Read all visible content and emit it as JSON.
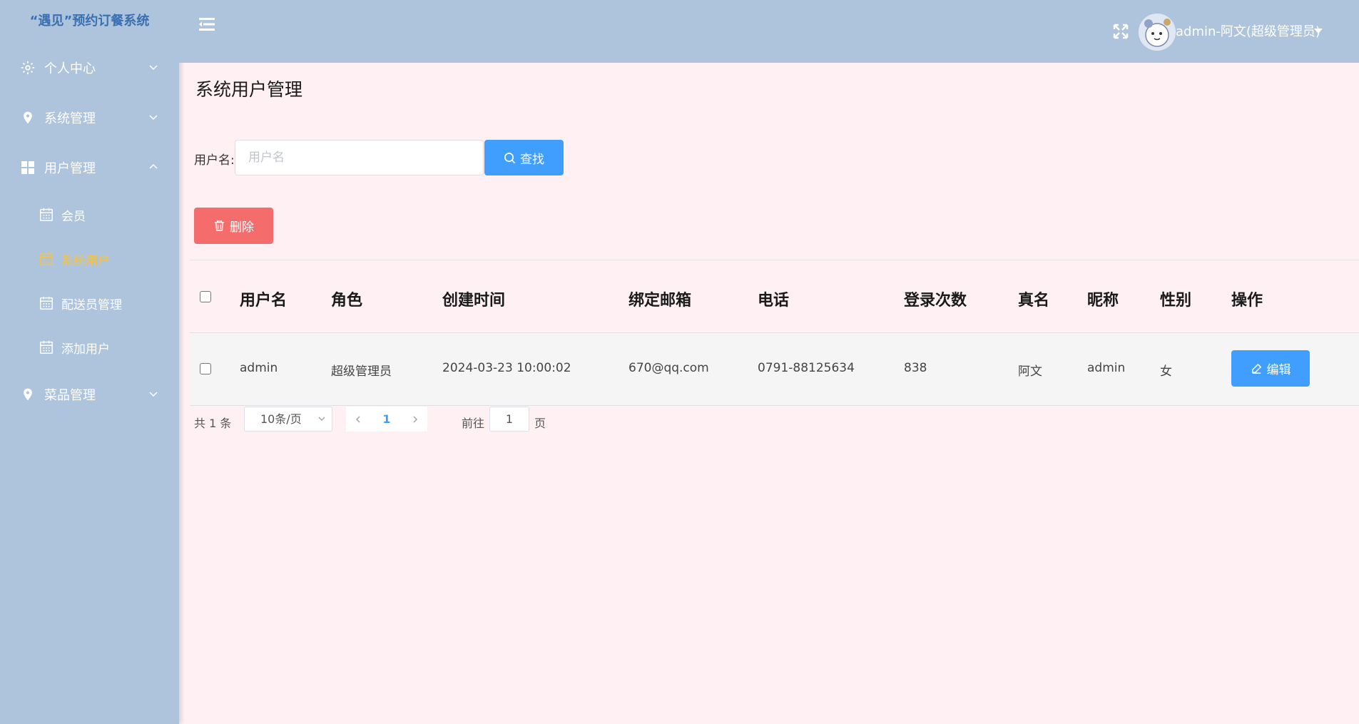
{
  "app": {
    "title": "“遇见”预约订餐系统"
  },
  "sidebar": {
    "items": [
      {
        "label": "个人中心",
        "icon": "gear-icon",
        "expanded": false
      },
      {
        "label": "系统管理",
        "icon": "location-pin-icon",
        "expanded": false
      },
      {
        "label": "用户管理",
        "icon": "grid-icon",
        "expanded": true,
        "children": [
          {
            "label": "会员",
            "icon": "calendar-icon",
            "active": false
          },
          {
            "label": "系统用户",
            "icon": "calendar-icon",
            "active": true
          },
          {
            "label": "配送员管理",
            "icon": "calendar-icon",
            "active": false
          },
          {
            "label": "添加用户",
            "icon": "calendar-icon",
            "active": false
          }
        ]
      },
      {
        "label": "菜品管理",
        "icon": "location-pin-icon",
        "expanded": false
      }
    ]
  },
  "header": {
    "user_label": "admin-阿文(超级管理员)"
  },
  "page": {
    "title": "系统用户管理",
    "search": {
      "label": "用户名:",
      "placeholder": "用户名",
      "value": "",
      "button_label": "查找"
    },
    "delete_label": "删除"
  },
  "table": {
    "columns": [
      "用户名",
      "角色",
      "创建时间",
      "绑定邮箱",
      "电话",
      "登录次数",
      "真名",
      "昵称",
      "性别",
      "操作"
    ],
    "rows": [
      {
        "username": "admin",
        "role": "超级管理员",
        "created": "2024-03-23 10:00:02",
        "email": "670@qq.com",
        "phone": "0791-88125634",
        "logins": "838",
        "realname": "阿文",
        "nickname": "admin",
        "gender": "女",
        "action_label": "编辑"
      }
    ]
  },
  "pagination": {
    "total": "共 1 条",
    "page_size": "10条/页",
    "current": "1",
    "goto_label": "前往",
    "goto_value": "1",
    "goto_suffix": "页"
  },
  "colors": {
    "sidebar_bg": "#aec3dc",
    "page_bg": "#fff0f4",
    "primary": "#409eff",
    "danger": "#f56c6c",
    "active_menu": "#f5c342",
    "title": "#3a6fb0"
  }
}
